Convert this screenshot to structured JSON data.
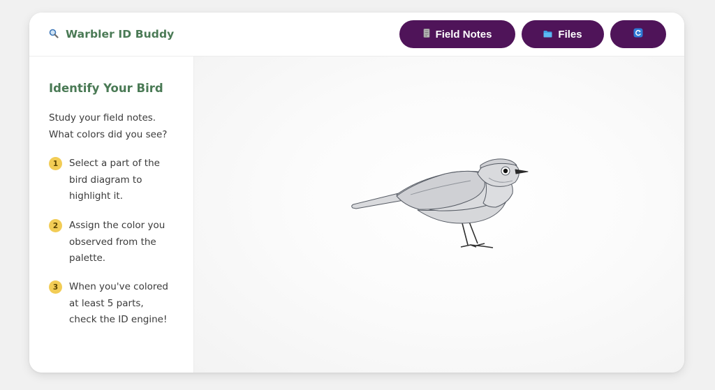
{
  "app": {
    "title": "Warbler ID Buddy"
  },
  "header": {
    "field_notes_label": "Field Notes",
    "files_label": "Files"
  },
  "sidebar": {
    "title": "Identify Your Bird",
    "intro": "Study your field notes. What colors did you see?",
    "steps": [
      {
        "number": "1",
        "text": "Select a part of the bird diagram to highlight it."
      },
      {
        "number": "2",
        "text": "Assign the color you observed from the palette."
      },
      {
        "number": "3",
        "text": "When you've colored at least 5 parts, check the ID engine!"
      }
    ]
  },
  "icons": {
    "brand": "search-icon",
    "field_notes": "notebook-icon",
    "files": "folder-icon",
    "reset": "refresh-icon"
  },
  "colors": {
    "brand_green": "#4a7a55",
    "button_purple": "#4f1459",
    "step_badge": "#f2cc55",
    "bird_fill": "#d9dadd"
  }
}
